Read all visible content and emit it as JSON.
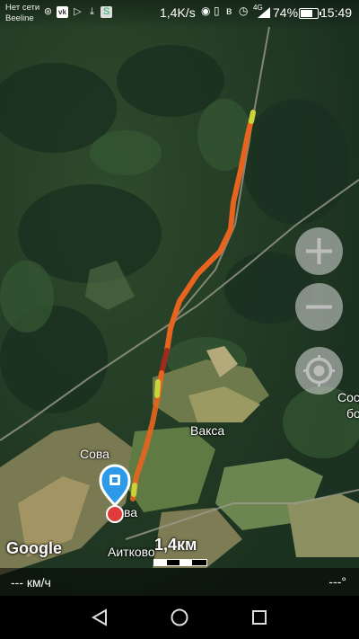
{
  "status_bar": {
    "carrier_line1": "Нет сети",
    "carrier_line2": "Beeline",
    "left_icons": [
      "vpn-icon",
      "vk-icon",
      "play-icon",
      "download-icon",
      "app-icon"
    ],
    "network_speed": "1,4K/s",
    "signal": "4G",
    "battery_percent": "74%",
    "battery_level": 0.74,
    "time": "15:49"
  },
  "map": {
    "labels": {
      "sova": "Сова",
      "sova_partial": "ва",
      "vaksa": "Вакса",
      "aitkovo": "Аитково",
      "edge_line1": "Сос",
      "edge_line2": "бо"
    },
    "attribution": "Google",
    "scale_text": "1,4км"
  },
  "controls": {
    "zoom_in": "+",
    "zoom_out": "−"
  },
  "info_bar": {
    "speed": "--- км/ч",
    "heading": "---°"
  },
  "colors": {
    "track_main": "#e8641e",
    "track_dark": "#a02a1c",
    "track_light": "#c8d43a",
    "marker_blue": "#2c9ae8",
    "marker_red": "#e03a3a"
  }
}
